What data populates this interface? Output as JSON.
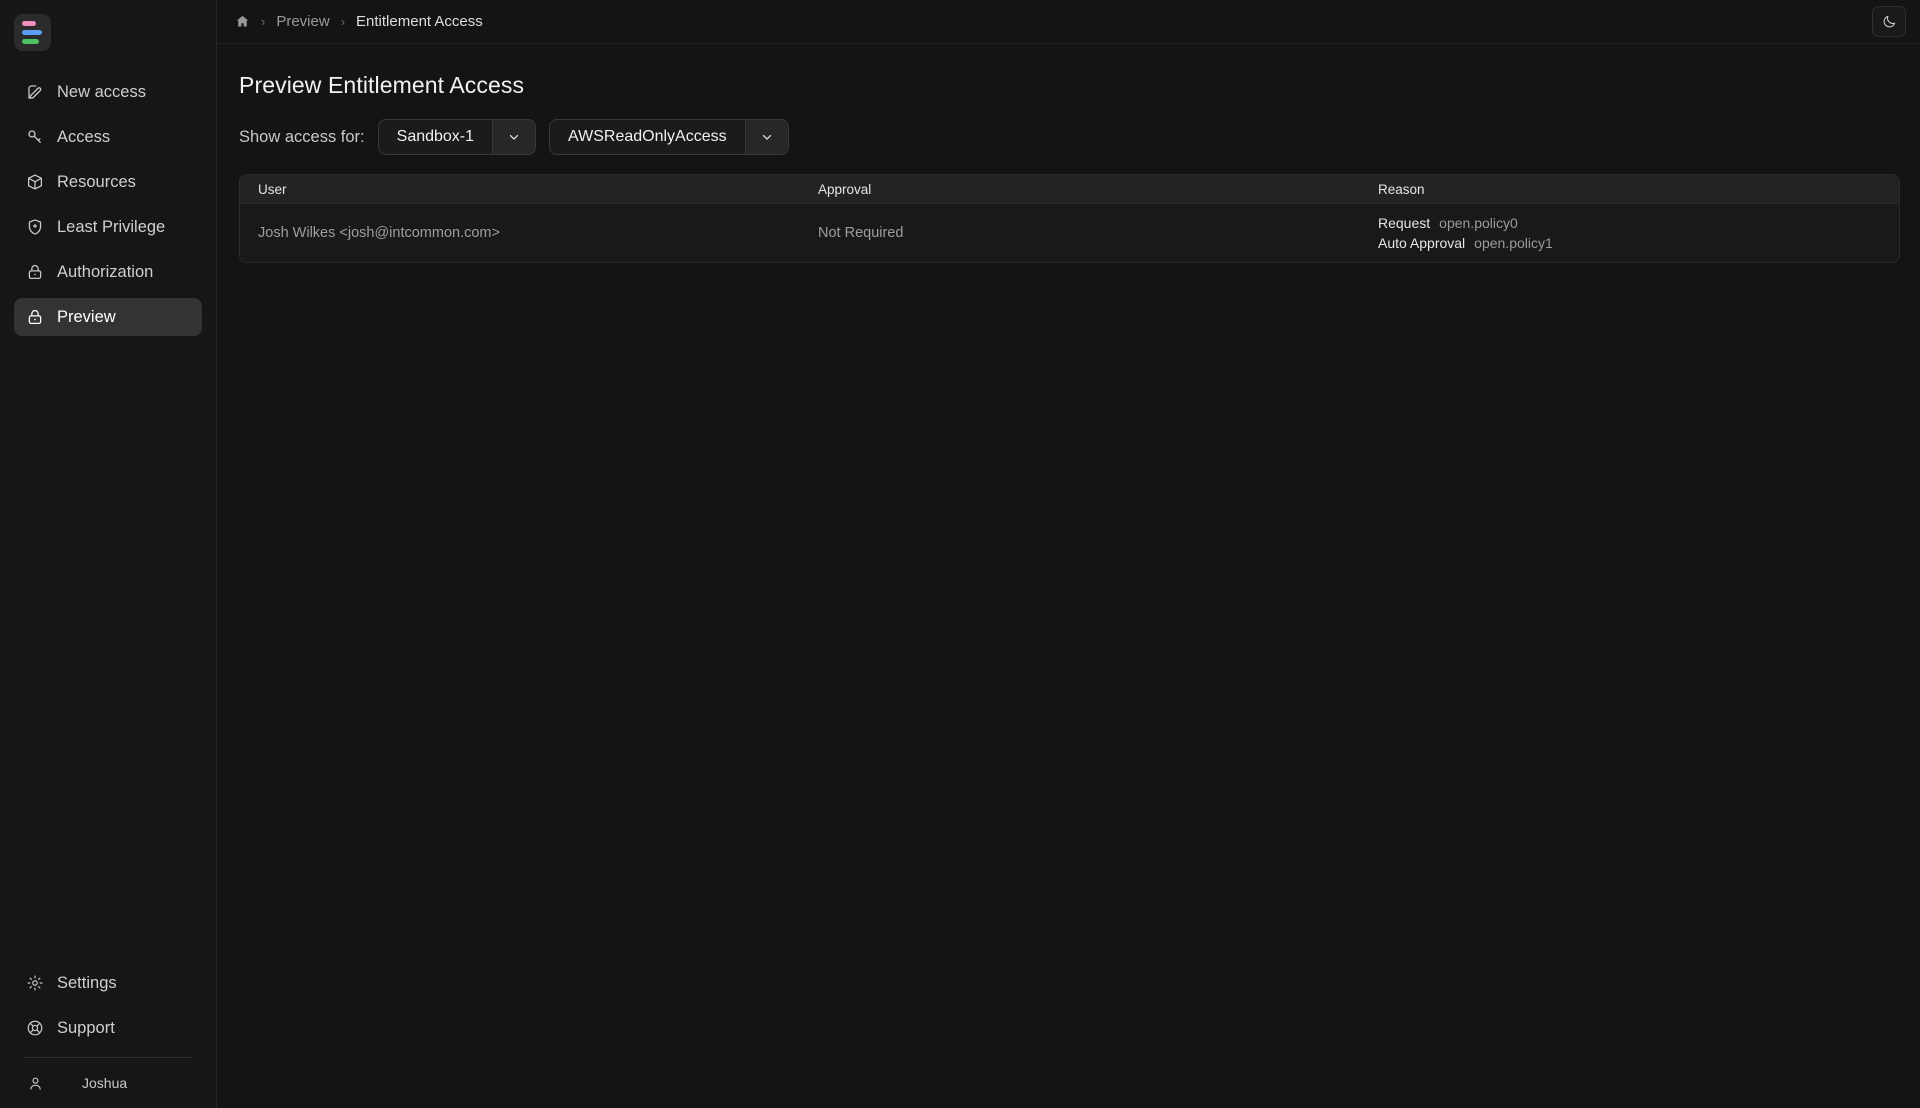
{
  "app": {
    "logo_name": "logo-bars",
    "logo_colors": [
      "#f08ec0",
      "#5b9cf5",
      "#4cc263"
    ]
  },
  "sidebar": {
    "items": [
      {
        "label": "New access",
        "icon": "pencil-square-icon",
        "active": false
      },
      {
        "label": "Access",
        "icon": "key-icon",
        "active": false
      },
      {
        "label": "Resources",
        "icon": "cube-icon",
        "active": false
      },
      {
        "label": "Least Privilege",
        "icon": "shield-plus-icon",
        "active": false
      },
      {
        "label": "Authorization",
        "icon": "lock-icon",
        "active": false
      },
      {
        "label": "Preview",
        "icon": "lock-icon",
        "active": true
      }
    ],
    "bottom_items": [
      {
        "label": "Settings",
        "icon": "gear-icon"
      },
      {
        "label": "Support",
        "icon": "lifebuoy-icon"
      }
    ],
    "user": {
      "name": "Joshua",
      "icon": "person-icon"
    }
  },
  "topbar": {
    "breadcrumb": {
      "home_icon": "home-icon",
      "separator": "›",
      "items": [
        {
          "label": "Preview",
          "current": false
        },
        {
          "label": "Entitlement Access",
          "current": true
        }
      ]
    },
    "theme_toggle": {
      "icon": "moon-icon",
      "label": "Toggle dark mode"
    }
  },
  "page": {
    "title": "Preview Entitlement Access",
    "filter_label": "Show access for:",
    "filters": [
      {
        "name": "account-select",
        "value": "Sandbox-1",
        "caret": "chevron-down-icon"
      },
      {
        "name": "permission-set-select",
        "value": "AWSReadOnlyAccess",
        "caret": "chevron-down-icon"
      }
    ]
  },
  "table": {
    "columns": [
      {
        "key": "user",
        "label": "User"
      },
      {
        "key": "approval",
        "label": "Approval"
      },
      {
        "key": "reason",
        "label": "Reason"
      }
    ],
    "rows": [
      {
        "user": "Josh Wilkes <josh@intcommon.com>",
        "approval": "Not Required",
        "reason": [
          {
            "key": "Request",
            "value": "open.policy0"
          },
          {
            "key": "Auto Approval",
            "value": "open.policy1"
          }
        ]
      }
    ]
  },
  "colors": {
    "background": "#141414",
    "sidebar": "#161616",
    "surface": "#191919",
    "header_row": "#232323",
    "accent_active": "#333333",
    "text_primary": "#f2f2f2",
    "text_muted": "#9e9e9e"
  }
}
